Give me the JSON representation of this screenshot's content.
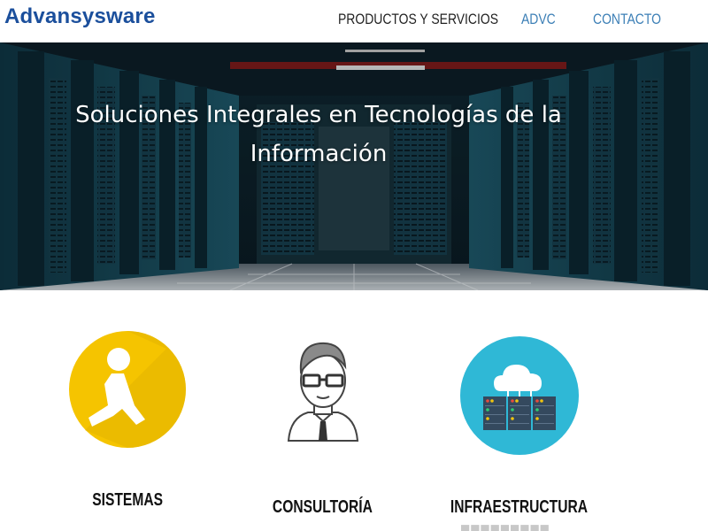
{
  "header": {
    "logo": "Advansysware",
    "nav": [
      {
        "label": "PRODUCTOS Y SERVICIOS"
      },
      {
        "label": "ADVC"
      },
      {
        "label": "CONTACTO"
      }
    ]
  },
  "hero": {
    "title_line1": "Soluciones Integrales en Tecnologías de la",
    "title_line2": "Información"
  },
  "services": [
    {
      "title": "SISTEMAS",
      "icon": "running-figure-icon"
    },
    {
      "title": "CONSULTORÍA",
      "icon": "consultant-icon"
    },
    {
      "title": "INFRAESTRUCTURA",
      "icon": "cloud-server-icon"
    }
  ],
  "colors": {
    "logo": "#1b4f9c",
    "nav_accent": "#3c7fb6",
    "sistemas_circle": "#f5c400",
    "infra_circle": "#2fb8d6"
  }
}
